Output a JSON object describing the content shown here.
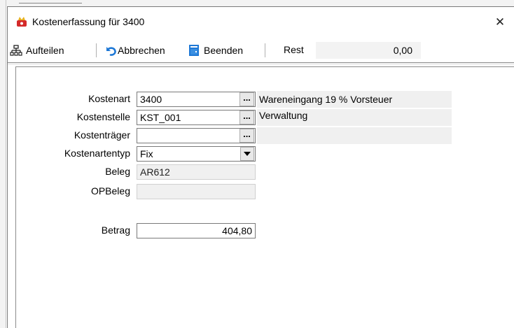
{
  "window": {
    "title": "Kostenerfassung für 3400",
    "close_symbol": "✕"
  },
  "toolbar": {
    "aufteilen_label": "Aufteilen",
    "abbrechen_label": "Abbrechen",
    "beenden_label": "Beenden",
    "rest_label": "Rest",
    "rest_value": "0,00"
  },
  "form": {
    "kostenart": {
      "label": "Kostenart",
      "value": "3400",
      "button": "...",
      "description": "Wareneingang 19 % Vorsteuer"
    },
    "kostenstelle": {
      "label": "Kostenstelle",
      "value": "KST_001",
      "button": "...",
      "description": "Verwaltung"
    },
    "kostentraeger": {
      "label": "Kostenträger",
      "value": "",
      "button": "...",
      "description": ""
    },
    "kostenartentyp": {
      "label": "Kostenartentyp",
      "value": "Fix"
    },
    "beleg": {
      "label": "Beleg",
      "value": "AR612"
    },
    "opbeleg": {
      "label": "OPBeleg",
      "value": ""
    },
    "betrag": {
      "label": "Betrag",
      "value": "404,80"
    }
  },
  "icons": {
    "window": "cost-entry-app-icon",
    "aufteilen": "split-tree-icon",
    "abbrechen": "undo-arrow-icon",
    "beenden": "exit-door-icon",
    "dropdown": "chevron-down-icon"
  },
  "colors": {
    "readonly_bg": "#f0f0f0",
    "accent_blue": "#1e78d6",
    "app_icon_red": "#d42a2a"
  }
}
